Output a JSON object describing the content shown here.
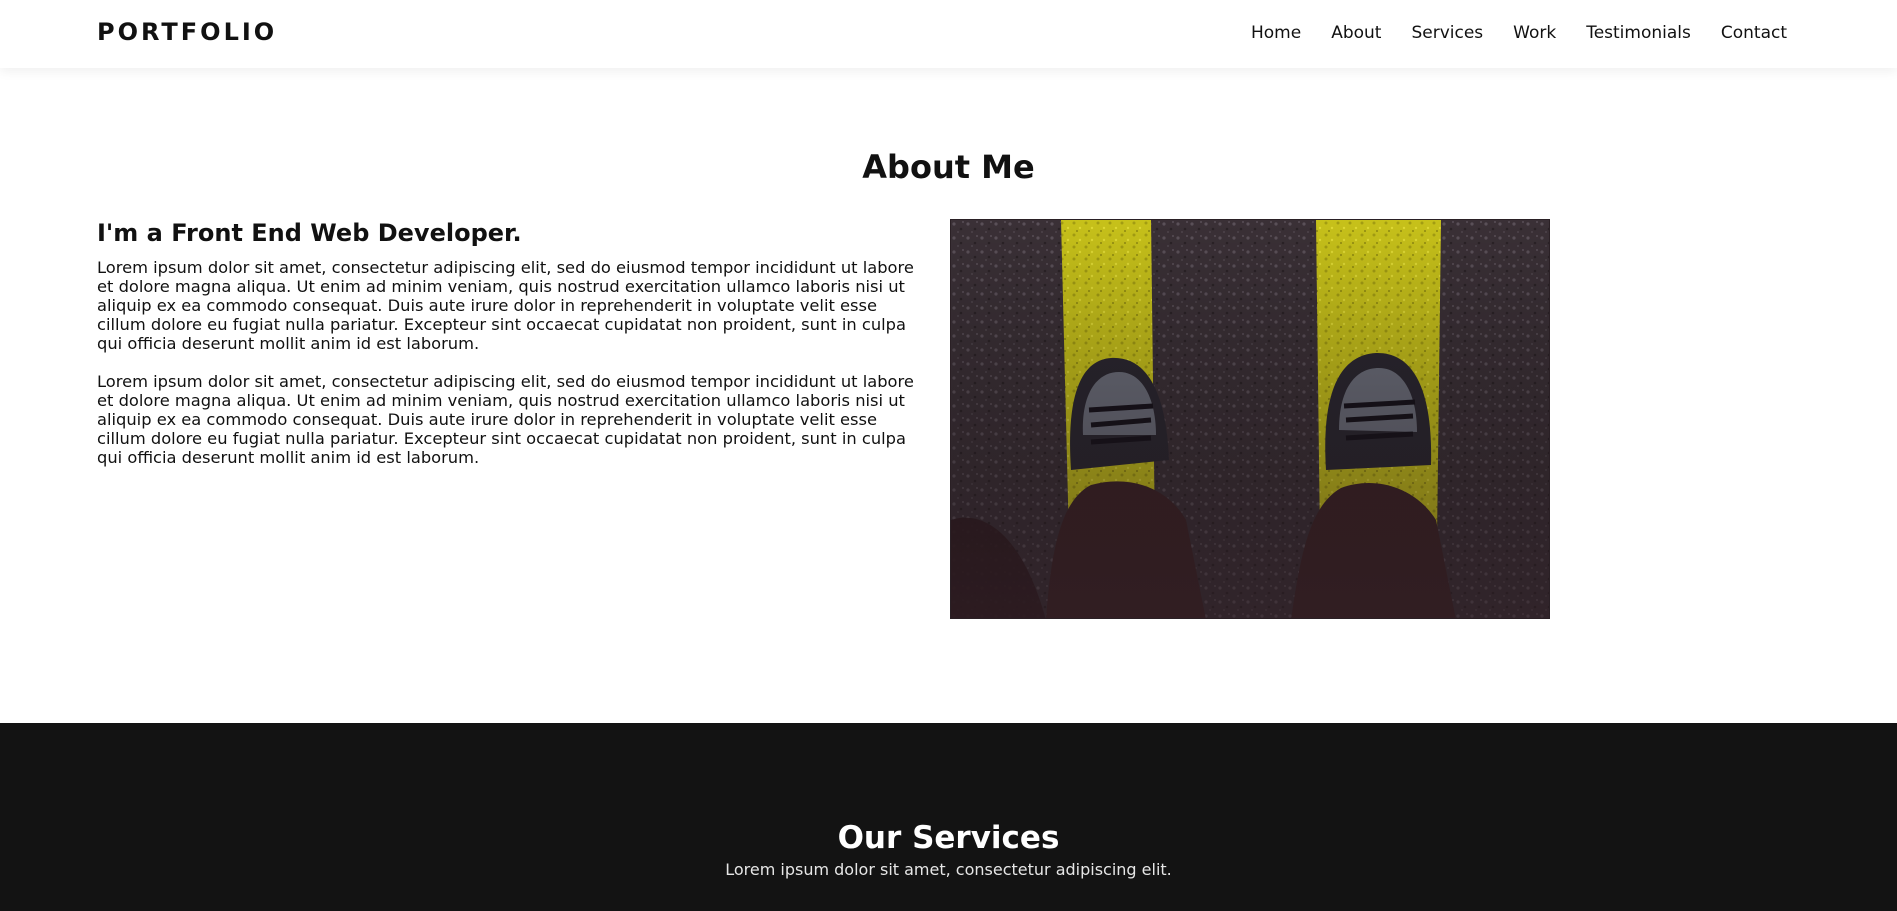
{
  "header": {
    "logo": "PORTFOLIO",
    "nav": [
      "Home",
      "About",
      "Services",
      "Work",
      "Testimonials",
      "Contact"
    ]
  },
  "about": {
    "title": "About Me",
    "subtitle": "I'm a Front End Web Developer.",
    "paragraphs": [
      "Lorem ipsum dolor sit amet, consectetur adipiscing elit, sed do eiusmod tempor incididunt ut labore et dolore magna aliqua. Ut enim ad minim veniam, quis nostrud exercitation ullamco laboris nisi ut aliquip ex ea commodo consequat. Duis aute irure dolor in reprehenderit in voluptate velit esse cillum dolore eu fugiat nulla pariatur. Excepteur sint occaecat cupidatat non proident, sunt in culpa qui officia deserunt mollit anim id est laborum.",
      "Lorem ipsum dolor sit amet, consectetur adipiscing elit, sed do eiusmod tempor incididunt ut labore et dolore magna aliqua. Ut enim ad minim veniam, quis nostrud exercitation ullamco laboris nisi ut aliquip ex ea commodo consequat. Duis aute irure dolor in reprehenderit in voluptate velit esse cillum dolore eu fugiat nulla pariatur. Excepteur sint occaecat cupidatat non proident, sunt in culpa qui officia deserunt mollit anim id est laborum."
    ]
  },
  "services": {
    "title": "Our Services",
    "subtitle": "Lorem ipsum dolor sit amet, consectetur adipiscing elit."
  },
  "colors": {
    "background": "#ffffff",
    "text": "#111111",
    "dark_section": "#131313",
    "road_line": "#c9c51a",
    "asphalt": "#3c3138"
  }
}
